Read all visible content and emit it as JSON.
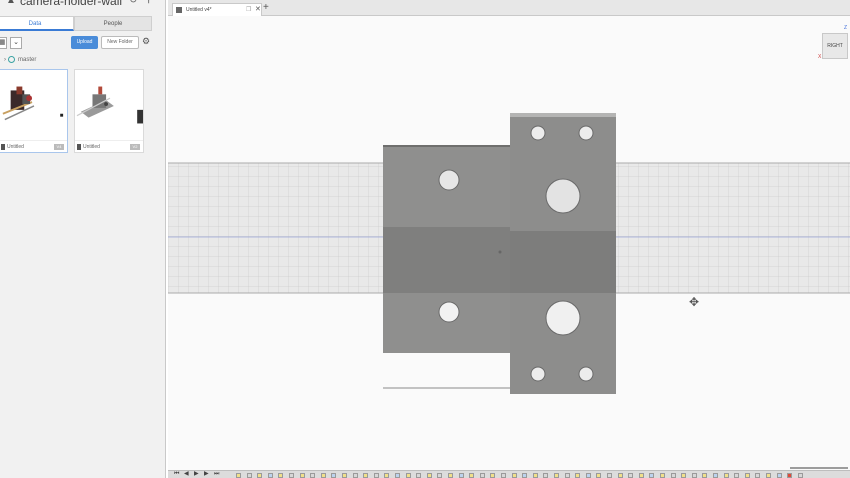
{
  "project": {
    "title": "camera-holder-wall"
  },
  "panel_tabs": [
    {
      "label": "Data",
      "active": true
    },
    {
      "label": "People",
      "active": false
    }
  ],
  "toolbar": {
    "upload_label": "Upload",
    "new_folder_label": "New Folder"
  },
  "branch": {
    "label": "master"
  },
  "files": [
    {
      "name": "Untitled",
      "version": "V4",
      "selected": true
    },
    {
      "name": "Untitled",
      "version": "V2",
      "selected": false
    }
  ],
  "document_tab": {
    "label": "Untitled v4*"
  },
  "viewcube": {
    "face_label": "RIGHT",
    "axis_z": "Z",
    "axis_x": "X"
  },
  "colors": {
    "accent": "#4a8cd9",
    "part": "#8f8f8e",
    "grid": "#cccccc"
  }
}
